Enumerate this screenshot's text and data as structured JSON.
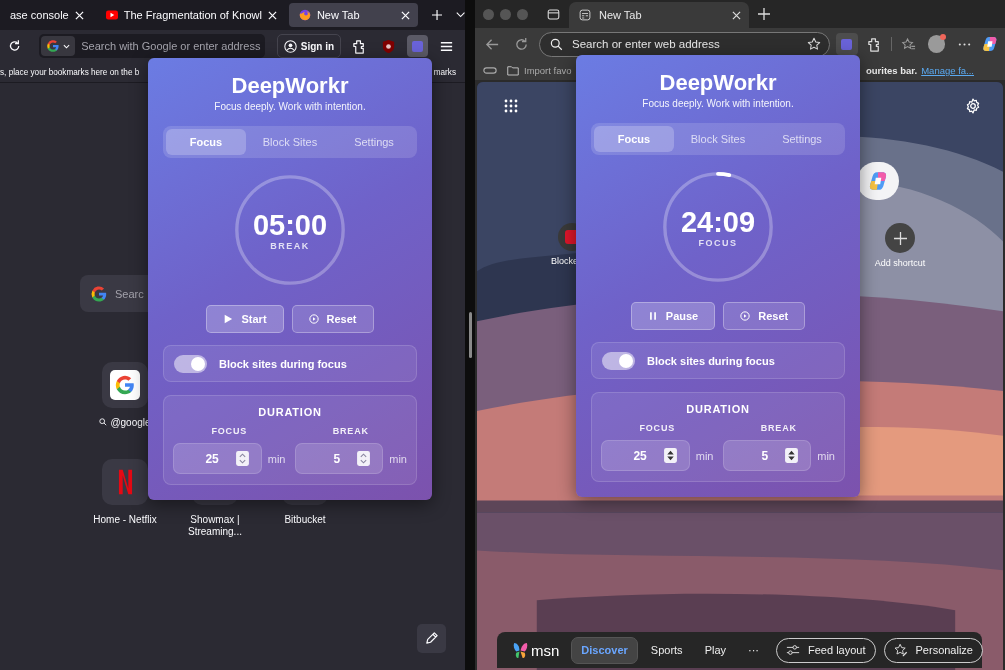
{
  "windows": [
    {
      "kind": "firefox",
      "tabs": [
        {
          "title": "ase console",
          "kind": "plain",
          "selected": false
        },
        {
          "title": "The Fragmentation of Knowl",
          "kind": "video",
          "selected": false
        },
        {
          "title": "New Tab",
          "kind": "browser",
          "selected": true
        }
      ],
      "address": {
        "placeholder": "Search with Google or enter address"
      },
      "sign_in": "Sign in",
      "bookmarks_hint": [
        "s, place your bookmarks here on the b",
        "marks"
      ],
      "newtab": {
        "search_placeholder": "Searc",
        "shortcut_rows": [
          [
            {
              "kind": "google",
              "label": "@google",
              "search": true
            }
          ],
          [
            {
              "kind": "netflix",
              "label": "Home - Netflix",
              "search": false
            },
            {
              "kind": "hidden",
              "label": "Showmax | Streaming...",
              "search": false
            },
            {
              "kind": "hidden",
              "label": "Bitbucket",
              "search": false
            }
          ]
        ]
      },
      "popup": {
        "title": "DeepWorkr",
        "subtitle": "Focus deeply. Work with intention.",
        "tabs": [
          {
            "label": "Focus",
            "selected": true
          },
          {
            "label": "Block Sites",
            "selected": false
          },
          {
            "label": "Settings",
            "selected": false
          }
        ],
        "timer": {
          "time": "05:00",
          "mode": "BREAK"
        },
        "buttons": [
          {
            "kind": "start",
            "label": "Start"
          },
          {
            "kind": "reset",
            "label": "Reset"
          }
        ],
        "toggle": {
          "label": "Block sites during focus",
          "on": true
        },
        "duration": {
          "title": "DURATION",
          "fields": [
            {
              "label": "FOCUS",
              "value": "25",
              "unit": "min"
            },
            {
              "label": "BREAK",
              "value": "5",
              "unit": "min"
            }
          ]
        }
      }
    },
    {
      "kind": "edge",
      "tabs": [
        {
          "title": "New Tab",
          "kind": "page",
          "selected": true
        }
      ],
      "address": {
        "placeholder": "Search or enter web address"
      },
      "favorites_bar": {
        "import": "Import favo",
        "hint": "ourites bar.",
        "link": "Manage fa..."
      },
      "newtab": {
        "shortcuts": [
          {
            "kind": "blocked",
            "label": "Blocke"
          },
          {
            "kind": "copilot"
          },
          {
            "kind": "add",
            "label": "Add shortcut"
          }
        ],
        "feed_bar": {
          "logo": "msn",
          "tabs": [
            {
              "label": "Discover",
              "selected": true
            },
            {
              "label": "Sports",
              "selected": false
            },
            {
              "label": "Play",
              "selected": false
            },
            {
              "label": "···",
              "selected": false
            }
          ],
          "buttons": [
            {
              "kind": "layout",
              "label": "Feed layout"
            },
            {
              "kind": "personalize",
              "label": "Personalize"
            }
          ]
        }
      },
      "popup": {
        "title": "DeepWorkr",
        "subtitle": "Focus deeply. Work with intention.",
        "tabs": [
          {
            "label": "Focus",
            "selected": true
          },
          {
            "label": "Block Sites",
            "selected": false
          },
          {
            "label": "Settings",
            "selected": false
          }
        ],
        "timer": {
          "time": "24:09",
          "mode": "FOCUS",
          "level": 0.034
        },
        "buttons": [
          {
            "kind": "pause",
            "label": "Pause"
          },
          {
            "kind": "reset",
            "label": "Reset"
          }
        ],
        "toggle": {
          "label": "Block sites during focus",
          "on": true
        },
        "duration": {
          "title": "DURATION",
          "fields": [
            {
              "label": "FOCUS",
              "value": "25",
              "unit": "min"
            },
            {
              "label": "BREAK",
              "value": "5",
              "unit": "min"
            }
          ]
        }
      }
    }
  ]
}
